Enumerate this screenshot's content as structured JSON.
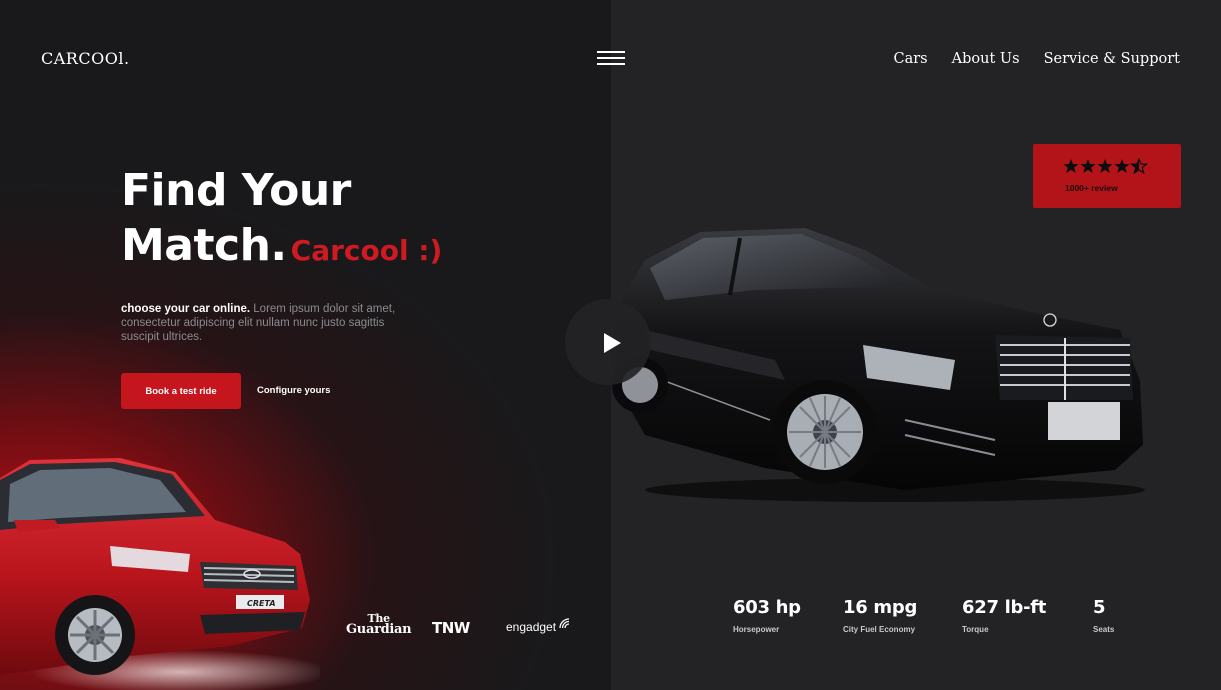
{
  "brand": {
    "logo": "CARCOOl."
  },
  "nav": {
    "items": [
      "Cars",
      "About Us",
      "Service & Support"
    ]
  },
  "hero": {
    "title_line1": "Find Your",
    "title_line2": "Match.",
    "title_accent": "Carcool :)",
    "desc_bold": "choose your car online.",
    "desc_rest": " Lorem ipsum dolor sit amet, consectetur adipiscing elit nullam nunc justo sagittis suscipit ultrices.",
    "primary_button": "Book a test ride",
    "secondary_link": "Configure yours"
  },
  "press": {
    "guardian_line1": "The",
    "guardian_line2": "Guardian",
    "tnw": "TNW",
    "engadget": "engadget"
  },
  "creta_badge": "CRETA",
  "review": {
    "rating": 4.5,
    "max": 5,
    "label": "1000+ review"
  },
  "stats": [
    {
      "value": "603 hp",
      "label": "Horsepower"
    },
    {
      "value": "16 mpg",
      "label": "City Fuel Economy"
    },
    {
      "value": "627 lb-ft",
      "label": "Torque"
    },
    {
      "value": "5",
      "label": "Seats"
    }
  ],
  "colors": {
    "accent": "#c4161c",
    "review_bg": "#b3141a",
    "left_bg": "#19191b",
    "right_bg": "#232325"
  },
  "icons": {
    "menu": "hamburger-icon",
    "play": "play-icon",
    "star": "star-icon"
  }
}
